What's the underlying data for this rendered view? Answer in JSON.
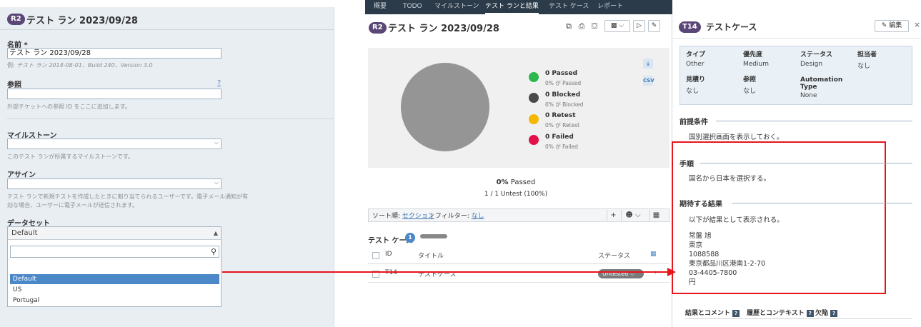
{
  "left": {
    "badge": "R2",
    "title": "テスト ラン 2023/09/28",
    "name_label": "名前 *",
    "name_value": "テスト ラン 2023/09/28",
    "name_hint_prefix": "例:",
    "name_hint_example": "テスト ラン 2014-08-01、Build 240、Version 3.0",
    "ref_label": "参照",
    "ref_help": "?",
    "ref_value": "",
    "ref_hint": "外部チケットへの参照 ID をここに追加します。",
    "milestone_label": "マイルストーン",
    "milestone_hint": "このテスト ランが所属するマイルストーンです。",
    "assign_label": "アサイン",
    "assign_hint_1": "テスト ランで新規テストを作成したときに割り当てられるユーザーです。電子メール通知が有",
    "assign_hint_2": "効な場合、ユーザーに電子メールが送信されます。",
    "dataset_label": "データセット",
    "dataset_selected": "Default",
    "dataset_search": "",
    "dataset_options": [
      "Default",
      "US",
      "Portugal"
    ]
  },
  "nav": {
    "tabs": [
      "概要",
      "TODO",
      "マイルストーン",
      "テスト ランと結果",
      "テスト ケース",
      "レポート"
    ],
    "active": "テスト ランと結果"
  },
  "center": {
    "badge": "R2",
    "title": "テスト ラン 2023/09/28",
    "legend": [
      {
        "name": "0 Passed",
        "sub": "0% が Passed",
        "color": "#2db84d"
      },
      {
        "name": "0 Blocked",
        "sub": "0% が Blocked",
        "color": "#4a4a4a"
      },
      {
        "name": "0 Retest",
        "sub": "0% が Retest",
        "color": "#f4b800"
      },
      {
        "name": "0 Failed",
        "sub": "0% が Failed",
        "color": "#e4104a"
      }
    ],
    "pie_color": "#959595",
    "csv_label": "CSV",
    "summary_pct": "0%",
    "summary_pct_label": "Passed",
    "summary_count": "1 / 1 Untest (100%)",
    "sort_label": "ソート順:",
    "sort_value": "セクション",
    "filter_label": "フィルター:",
    "filter_value": "なし",
    "tc_title": "テスト ケース",
    "tc_count": "1",
    "col_id": "ID",
    "col_title": "タイトル",
    "col_status": "ステータス",
    "row": {
      "id": "T14",
      "title": "テストケース",
      "status": "Untested"
    }
  },
  "right": {
    "badge": "T14",
    "title": "テストケース",
    "edit_label": "編集",
    "close": "×",
    "props": {
      "type_k": "タイプ",
      "type_v": "Other",
      "priority_k": "優先度",
      "priority_v": "Medium",
      "status_k": "ステータス",
      "status_v": "Design",
      "owner_k": "担当者",
      "owner_v": "なし",
      "estimate_k": "見積り",
      "estimate_v": "なし",
      "ref_k": "参照",
      "ref_v": "なし",
      "auto_k1": "Automation",
      "auto_k2": "Type",
      "auto_v": "None"
    },
    "precond_title": "前提条件",
    "precond_text": "国別選択画面を表示しておく。",
    "steps_title": "手順",
    "steps_text": "国名から日本を選択する。",
    "expected_title": "期待する結果",
    "expected_intro": "以下が結果として表示される。",
    "expected_lines": [
      "常盤 旭",
      "東京",
      "1088588",
      "東京都品川区港南1-2-70",
      "03-4405-7800",
      "円"
    ],
    "tabs": [
      "結果とコメント",
      "履歴とコンテキスト",
      "欠陥"
    ],
    "tab_help": "?"
  },
  "annotation": {
    "color": "#e8141b"
  }
}
